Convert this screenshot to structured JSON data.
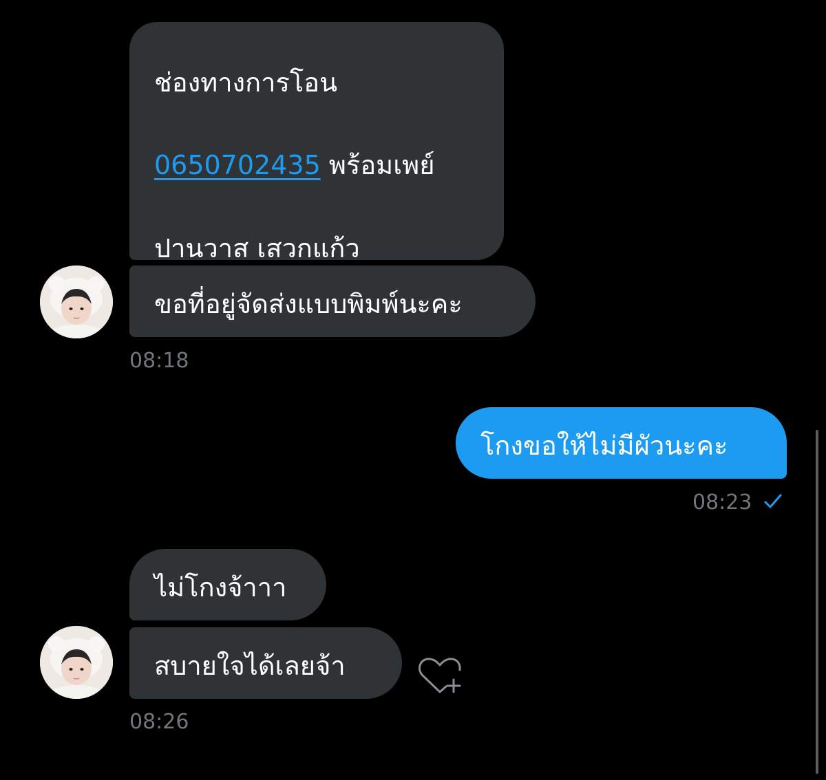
{
  "messages": [
    {
      "id": "m1",
      "direction": "received",
      "line1": "ช่องทางการโอน",
      "phone": "0650702435",
      "line2_suffix": " พร้อมเพย์",
      "line3": "ปานวาส เสวกแก้ว"
    },
    {
      "id": "m2",
      "direction": "received",
      "text": "ขอที่อยู่จัดส่งแบบพิมพ์นะคะ",
      "time": "08:18"
    },
    {
      "id": "m3",
      "direction": "sent",
      "text": "โกงขอให้ไม่มีผัวนะคะ",
      "time": "08:23",
      "status_icon": "check-icon"
    },
    {
      "id": "m4",
      "direction": "received",
      "text": "ไม่โกงจ้าาา"
    },
    {
      "id": "m5",
      "direction": "received",
      "text": "สบายใจได้เลยจ้า",
      "time": "08:26",
      "reaction_icon": "heart-add-icon"
    }
  ],
  "colors": {
    "background": "#000000",
    "received_bubble": "#2f3336",
    "sent_bubble": "#1d9bf0",
    "link": "#1d9bf0",
    "timestamp": "#71767b"
  }
}
